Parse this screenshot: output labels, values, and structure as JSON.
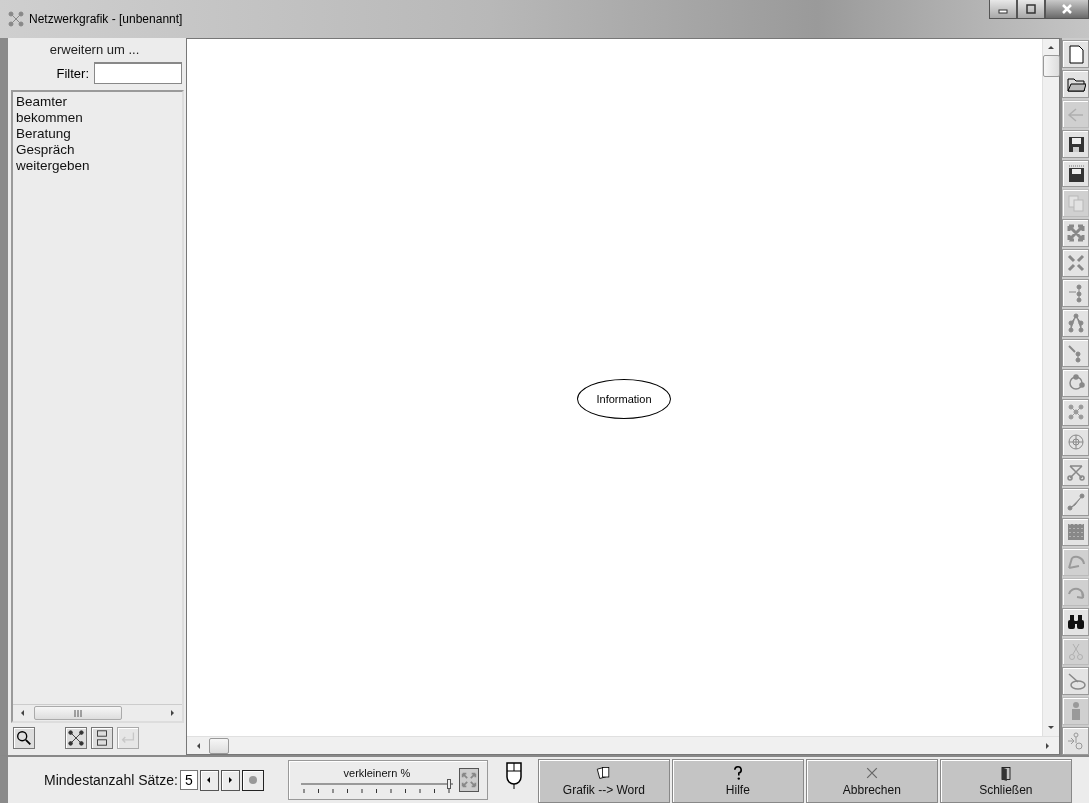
{
  "window": {
    "title": "Netzwerkgrafik - [unbenannt]"
  },
  "sidebar": {
    "heading": "erweitern um ...",
    "filter": {
      "label": "Filter:"
    },
    "items": [
      {
        "label": "Beamter"
      },
      {
        "label": "bekommen"
      },
      {
        "label": "Beratung"
      },
      {
        "label": "Gespräch"
      },
      {
        "label": "weitergeben"
      }
    ],
    "tools": [
      {
        "disabled": false
      },
      {
        "disabled": false
      },
      {
        "disabled": false
      },
      {
        "disabled": true
      }
    ]
  },
  "canvas": {
    "nodes": [
      {
        "label": "Information"
      }
    ]
  },
  "toolbar": [
    {
      "disabled": false
    },
    {
      "disabled": false
    },
    {
      "disabled": true
    },
    {
      "disabled": false
    },
    {
      "disabled": false
    },
    {
      "disabled": true
    },
    {
      "disabled": false
    },
    {
      "disabled": false
    },
    {
      "disabled": false
    },
    {
      "disabled": false
    },
    {
      "disabled": false
    },
    {
      "disabled": false
    },
    {
      "disabled": false
    },
    {
      "disabled": false
    },
    {
      "disabled": false
    },
    {
      "disabled": false
    },
    {
      "disabled": false
    },
    {
      "disabled": true
    },
    {
      "disabled": true
    },
    {
      "disabled": false
    },
    {
      "disabled": true
    },
    {
      "disabled": false
    },
    {
      "disabled": true
    },
    {
      "disabled": false
    }
  ],
  "bottom": {
    "min_label": "Mindestanzahl Sätze:",
    "min_value": "5",
    "zoom": {
      "label": "verkleinern %",
      "level": 1
    },
    "buttons": [
      {
        "label": "Grafik --> Word"
      },
      {
        "label": "Hilfe"
      },
      {
        "label": "Abbrechen"
      },
      {
        "label": "Schließen"
      }
    ]
  }
}
